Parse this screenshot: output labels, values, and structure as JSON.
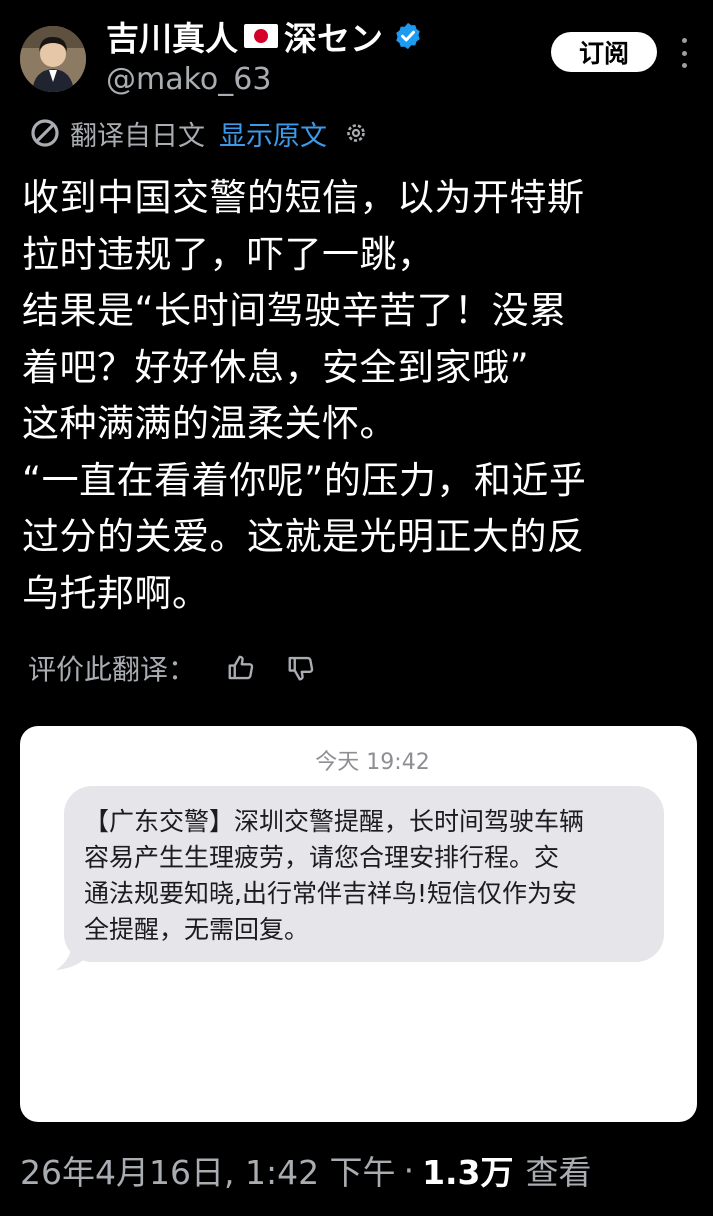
{
  "author": {
    "display_name": "吉川真人",
    "display_name_suffix": "深セン",
    "handle": "@mako_63"
  },
  "actions": {
    "subscribe_label": "订阅"
  },
  "translation": {
    "source_label": "翻译自日文",
    "show_original_label": "显示原文",
    "rate_label": "评价此翻译："
  },
  "tweet": {
    "lines": [
      "收到中国交警的短信，以为开特斯",
      "拉时违规了，吓了一跳，",
      "结果是“长时间驾驶辛苦了！没累",
      "着吧？好好休息，安全到家哦”",
      "这种满满的温柔关怀。",
      "“一直在看着你呢”的压力，和近乎",
      "过分的关爱。这就是光明正大的反",
      "乌托邦啊。"
    ]
  },
  "sms": {
    "time": "今天 19:42",
    "lines": [
      "【广东交警】深圳交警提醒，长时间驾驶车辆",
      "容易产生生理疲劳，请您合理安排行程。交",
      "通法规要知晓,出行常伴吉祥鸟!短信仅作为安",
      "全提醒，无需回复。"
    ]
  },
  "meta": {
    "timestamp": "26年4月16日, 1:42 下午",
    "separator": "·",
    "views_count": "1.3万",
    "views_label": "查看"
  },
  "colors": {
    "background": "#000000",
    "link": "#3b9aea",
    "verified": "#1d9bf0",
    "muted": "#a9adb2",
    "flag_red": "#d4002a"
  },
  "icons": [
    "verified-badge-icon",
    "japan-flag-icon",
    "translate-icon",
    "gear-icon",
    "more-icon",
    "thumbs-up-icon",
    "thumbs-down-icon"
  ]
}
